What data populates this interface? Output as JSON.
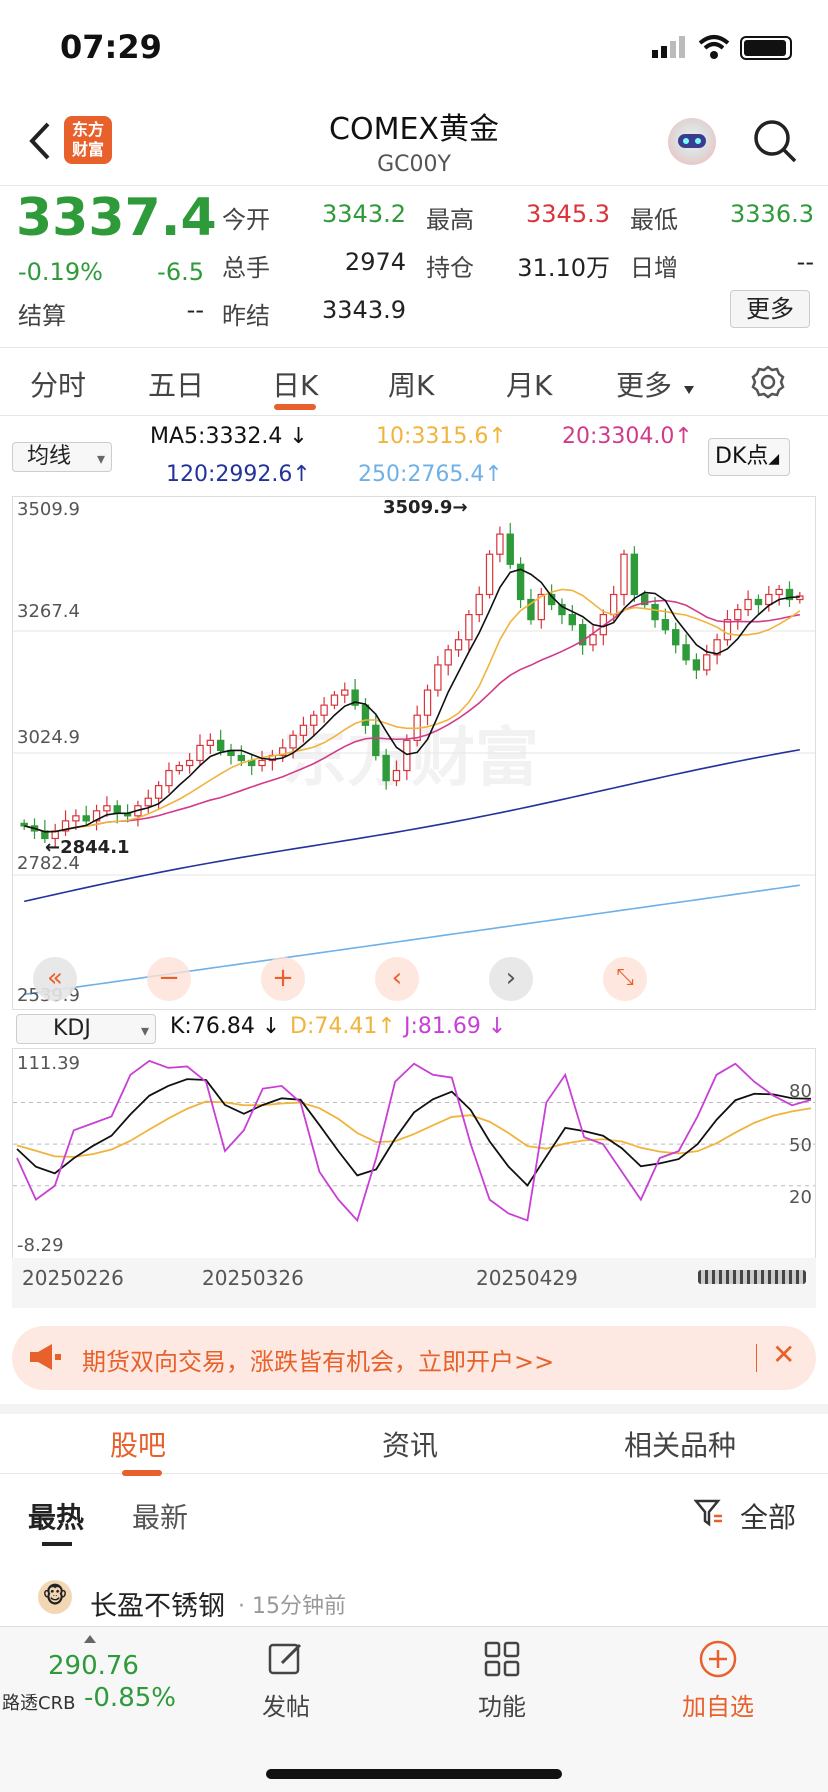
{
  "status": {
    "time": "07:29"
  },
  "header": {
    "title": "COMEX黄金",
    "code": "GC00Y",
    "logo_text": "东方\n财富"
  },
  "quote": {
    "price": "3337.4",
    "change_pct": "-0.19%",
    "change": "-6.5",
    "settle_label": "结算",
    "settle": "--",
    "open_label": "今开",
    "open": "3343.2",
    "high_label": "最高",
    "high": "3345.3",
    "low_label": "最低",
    "low": "3336.3",
    "vol_label": "总手",
    "vol": "2974",
    "oi_label": "持仓",
    "oi": "31.10万",
    "daily_label": "日增",
    "daily": "--",
    "prev_label": "昨结",
    "prev": "3343.9",
    "more": "更多"
  },
  "periods": [
    {
      "label": "分时"
    },
    {
      "label": "五日"
    },
    {
      "label": "日K"
    },
    {
      "label": "周K"
    },
    {
      "label": "月K"
    },
    {
      "label": "更多"
    }
  ],
  "ma": {
    "select": "均线",
    "ma5": "MA5:3332.4",
    "ma10": "10:3315.6",
    "ma20": "20:3304.0",
    "ma120": "120:2992.6",
    "ma250": "250:2765.4",
    "dk": "DK点"
  },
  "chart_data": {
    "type": "candlestick",
    "y_ticks": [
      "3509.9",
      "3267.4",
      "3024.9",
      "2782.4",
      "2539.9"
    ],
    "ylim": [
      2539.9,
      3509.9
    ],
    "max_label": "3509.9",
    "min_label": "2844.1",
    "watermark": "东方财富",
    "dates": [
      "20250226",
      "20250326",
      "20250429"
    ],
    "kdj": {
      "select": "KDJ",
      "k": "K:76.84",
      "d": "D:74.41",
      "j": "J:81.69",
      "y_top": "111.39",
      "y_bottom": "-8.29",
      "levels": [
        "80",
        "50",
        "20"
      ]
    }
  },
  "colors": {
    "up": "#d9343b",
    "down": "#2e9a3a",
    "ma5": "#111111",
    "ma10": "#f0b43c",
    "ma20": "#d13b8a",
    "ma120": "#23339a",
    "ma250": "#6fb0e6",
    "accent": "#e8612c"
  },
  "banner": {
    "text": "期货双向交易，涨跌皆有机会，立即开户>>"
  },
  "tabs2": [
    {
      "label": "股吧"
    },
    {
      "label": "资讯"
    },
    {
      "label": "相关品种"
    }
  ],
  "subtabs": {
    "hot": "最热",
    "new": "最新",
    "filter": "全部"
  },
  "post": {
    "user": "长盈不锈钢",
    "time": "· 15分钟前"
  },
  "bottom": {
    "index_value": "290.76",
    "index_name": "路透CRB",
    "index_change": "-0.85%",
    "post": "发帖",
    "func": "功能",
    "watch": "加自选"
  }
}
